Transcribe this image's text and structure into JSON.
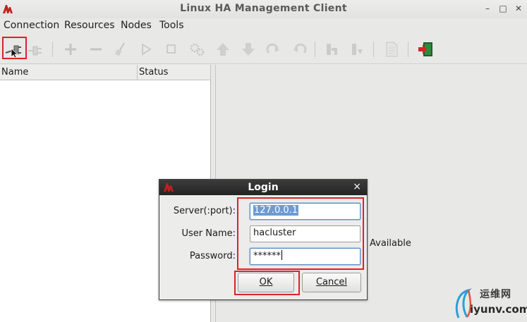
{
  "window": {
    "title": "Linux HA Management Client",
    "controls": {
      "minimize": "–",
      "maximize": "□",
      "close": "✕"
    }
  },
  "menu": {
    "items": [
      "Connection",
      "Resources",
      "Nodes",
      "Tools"
    ]
  },
  "toolbar": {
    "buttons": [
      {
        "icon": "connect-icon",
        "enabled": true,
        "highlighted": true
      },
      {
        "icon": "disconnect-icon",
        "enabled": false
      },
      {
        "icon": "add-icon",
        "enabled": false
      },
      {
        "icon": "remove-icon",
        "enabled": false
      },
      {
        "icon": "cleanup-broom-icon",
        "enabled": false
      },
      {
        "icon": "start-icon",
        "enabled": false
      },
      {
        "icon": "stop-icon",
        "enabled": false
      },
      {
        "icon": "default-gears-icon",
        "enabled": false
      },
      {
        "icon": "move-up-icon",
        "enabled": false
      },
      {
        "icon": "move-down-icon",
        "enabled": false
      },
      {
        "icon": "migrate-icon",
        "enabled": false
      },
      {
        "icon": "unmigrate-icon",
        "enabled": false
      },
      {
        "icon": "standby-node-icon",
        "enabled": false
      },
      {
        "icon": "active-node-icon",
        "enabled": false
      },
      {
        "icon": "view-xml-icon",
        "enabled": false
      },
      {
        "icon": "quit-exit-icon",
        "enabled": true
      }
    ]
  },
  "tree": {
    "columns": [
      "Name",
      "Status"
    ]
  },
  "main": {
    "status_text": "Available"
  },
  "login_dialog": {
    "title": "Login",
    "close_glyph": "×",
    "server_label": "Server(:port):",
    "server_value": "127.0.0.1",
    "user_label": "User Name:",
    "user_value": "hacluster",
    "password_label": "Password:",
    "password_masked": "******",
    "ok_label": "OK",
    "cancel_label": "Cancel"
  },
  "watermark": {
    "text_cn": "运维网",
    "text_url": "iyunv.com"
  },
  "colors": {
    "highlight_box": "#d9232a",
    "app_icon_red": "#c0211d",
    "selection": "#6d9bd0",
    "dialog_title_bg": "#2f2f2f"
  }
}
